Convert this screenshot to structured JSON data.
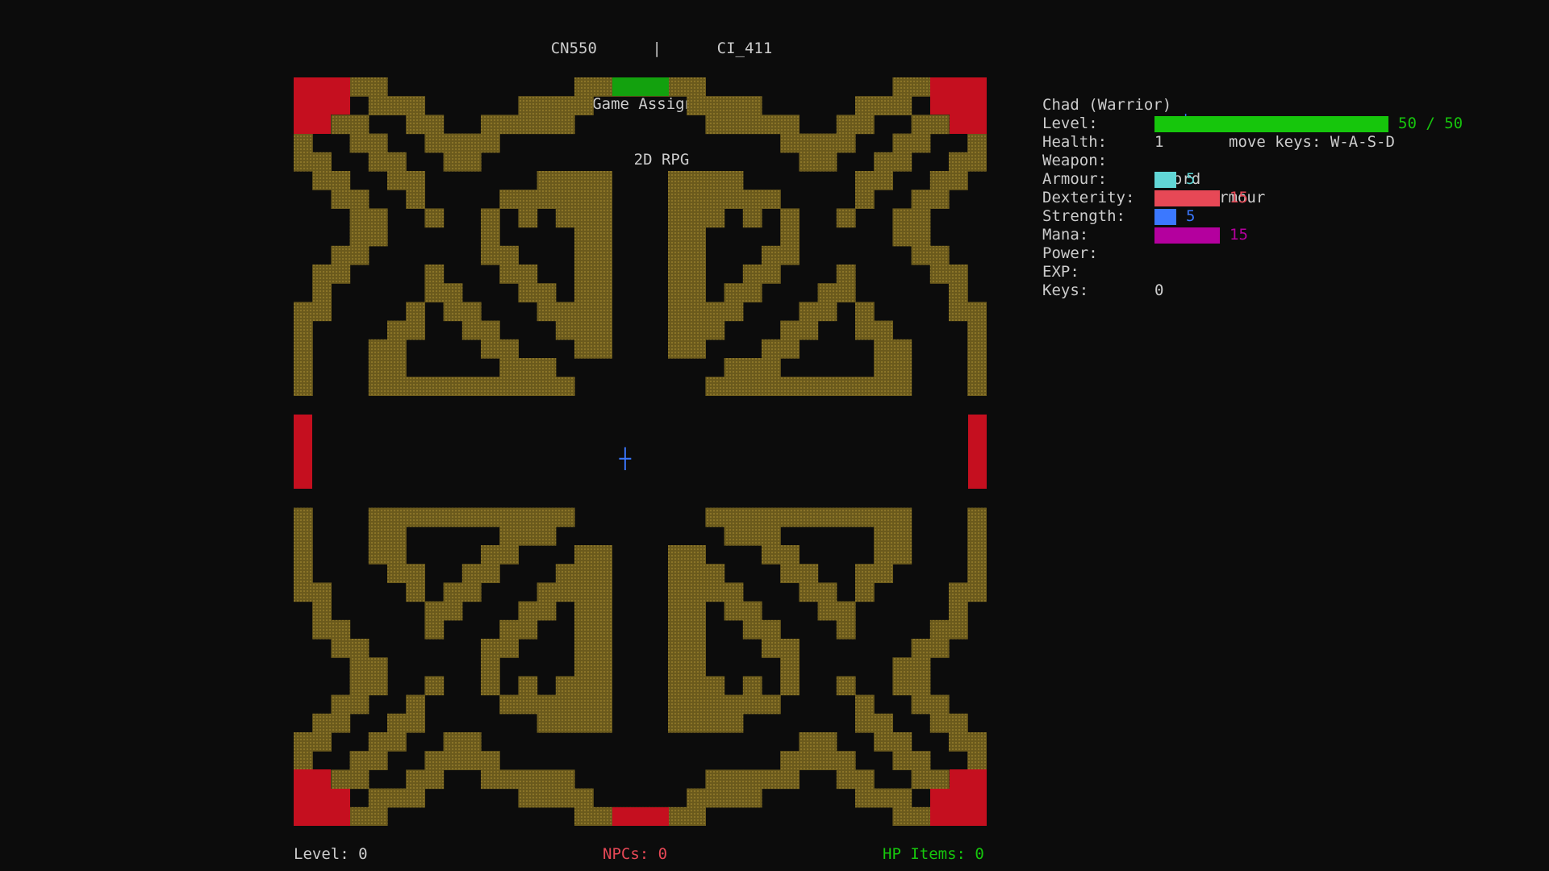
{
  "header": {
    "line1_left": "CN550",
    "line1_sep": "|",
    "line1_right": "CI_411",
    "line2": "Game Assignment",
    "line3": "2D RPG"
  },
  "player": {
    "name": "Chad (Warrior)",
    "glyph": "┼",
    "move_keys": "move keys: W-A-S-D"
  },
  "stats": {
    "level": {
      "label": "Level:",
      "value": "1"
    },
    "health": {
      "label": "Health:",
      "value": "50 / 50",
      "current": 50,
      "max": 50,
      "color": "#16c60c"
    },
    "weapon": {
      "label": "Weapon:",
      "value": "Sword"
    },
    "armour": {
      "label": "Armour:",
      "value": "Plate Armour"
    },
    "dexterity": {
      "label": "Dexterity:",
      "value": "5",
      "color": "#61d6d6"
    },
    "strength": {
      "label": "Strength:",
      "value": "15",
      "color": "#e74856"
    },
    "mana": {
      "label": "Mana:",
      "value": "5",
      "color": "#3b78ff"
    },
    "power": {
      "label": "Power:",
      "value": "15",
      "color": "#b4009e"
    },
    "exp": {
      "label": "EXP:",
      "value": "0"
    },
    "keys": {
      "label": "Keys:",
      "value": ""
    }
  },
  "footer": {
    "level": "Level: 0",
    "npcs": "NPCs: 0",
    "hp_items": "HP Items: 0"
  },
  "colors": {
    "wall": "#6b5a1c",
    "wall_dot": "#8a7428",
    "door_red": "#c50f1f",
    "door_green": "#13a10e",
    "player": "#3b78ff",
    "background": "#0c0c0c",
    "text": "#cccccc"
  }
}
